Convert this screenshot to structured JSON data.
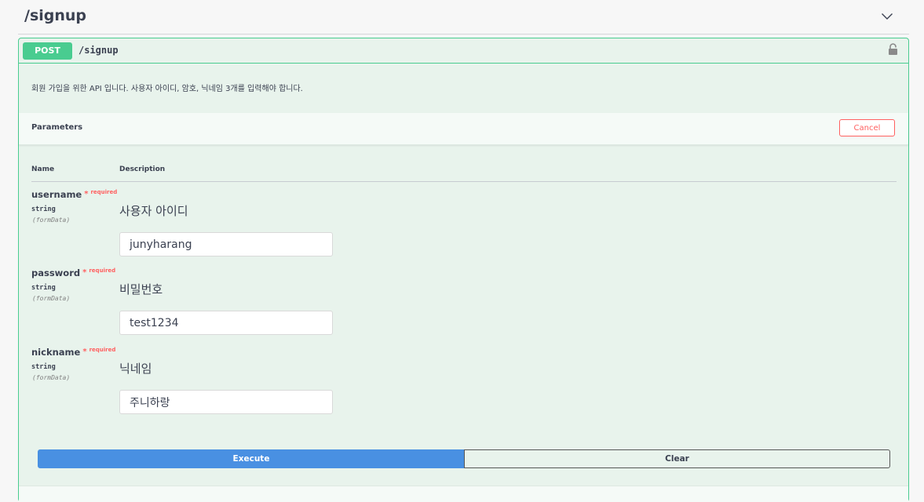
{
  "tag": {
    "title": "/signup"
  },
  "operation": {
    "method": "POST",
    "path": "/signup",
    "description": "회원 가입을 위한 API 입니다. 사용자 아이디, 암호, 닉네임 3개를 입력해야 합니다."
  },
  "parameters": {
    "title": "Parameters",
    "cancel_label": "Cancel",
    "col_name": "Name",
    "col_description": "Description",
    "required_star": "*",
    "required_label": "required",
    "items": [
      {
        "name": "username",
        "type": "string",
        "in": "(formData)",
        "description": "사용자 아이디",
        "value": "junyharang"
      },
      {
        "name": "password",
        "type": "string",
        "in": "(formData)",
        "description": "비밀번호",
        "value": "test1234"
      },
      {
        "name": "nickname",
        "type": "string",
        "in": "(formData)",
        "description": "닉네임",
        "value": "주니하랑"
      }
    ]
  },
  "actions": {
    "execute_label": "Execute",
    "clear_label": "Clear"
  },
  "colors": {
    "post_green": "#49cc90",
    "execute_blue": "#4990e2",
    "required_red": "#ff6060"
  },
  "icons": {
    "collapse": "chevron-up-icon",
    "lock": "lock-icon"
  }
}
